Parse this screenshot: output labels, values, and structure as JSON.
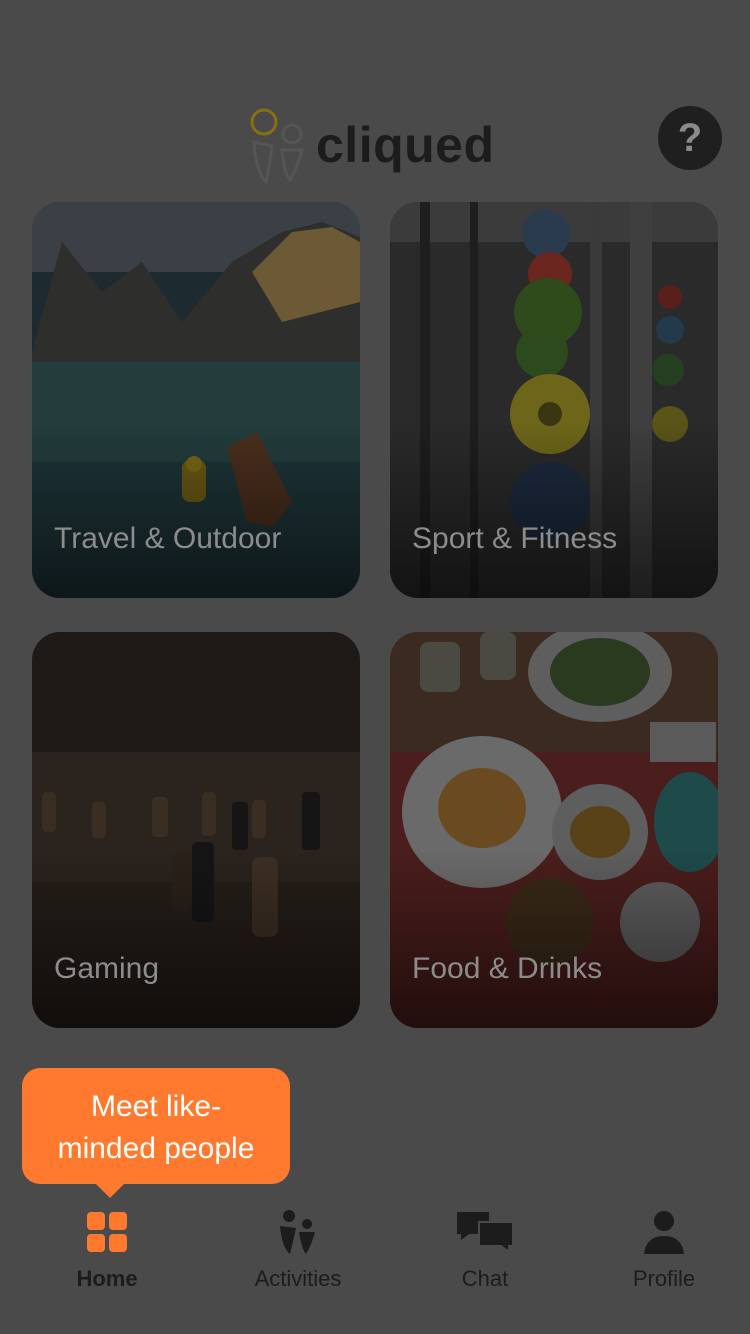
{
  "app": {
    "logo_text": "cliqued",
    "help_label": "?"
  },
  "categories": [
    {
      "label": "Travel & Outdoor"
    },
    {
      "label": "Sport & Fitness"
    },
    {
      "label": "Gaming"
    },
    {
      "label": "Food & Drinks"
    }
  ],
  "tooltip": {
    "text": "Meet like-minded people"
  },
  "tabs": {
    "home": {
      "label": "Home",
      "icon": "grid-icon"
    },
    "activities": {
      "label": "Activities",
      "icon": "people-icon"
    },
    "chat": {
      "label": "Chat",
      "icon": "chat-bubbles-icon"
    },
    "profile": {
      "label": "Profile",
      "icon": "person-icon"
    }
  },
  "colors": {
    "accent": "#ff7a2f",
    "overlay": "#4a4a4a",
    "logo_ring": "#c9a227"
  }
}
